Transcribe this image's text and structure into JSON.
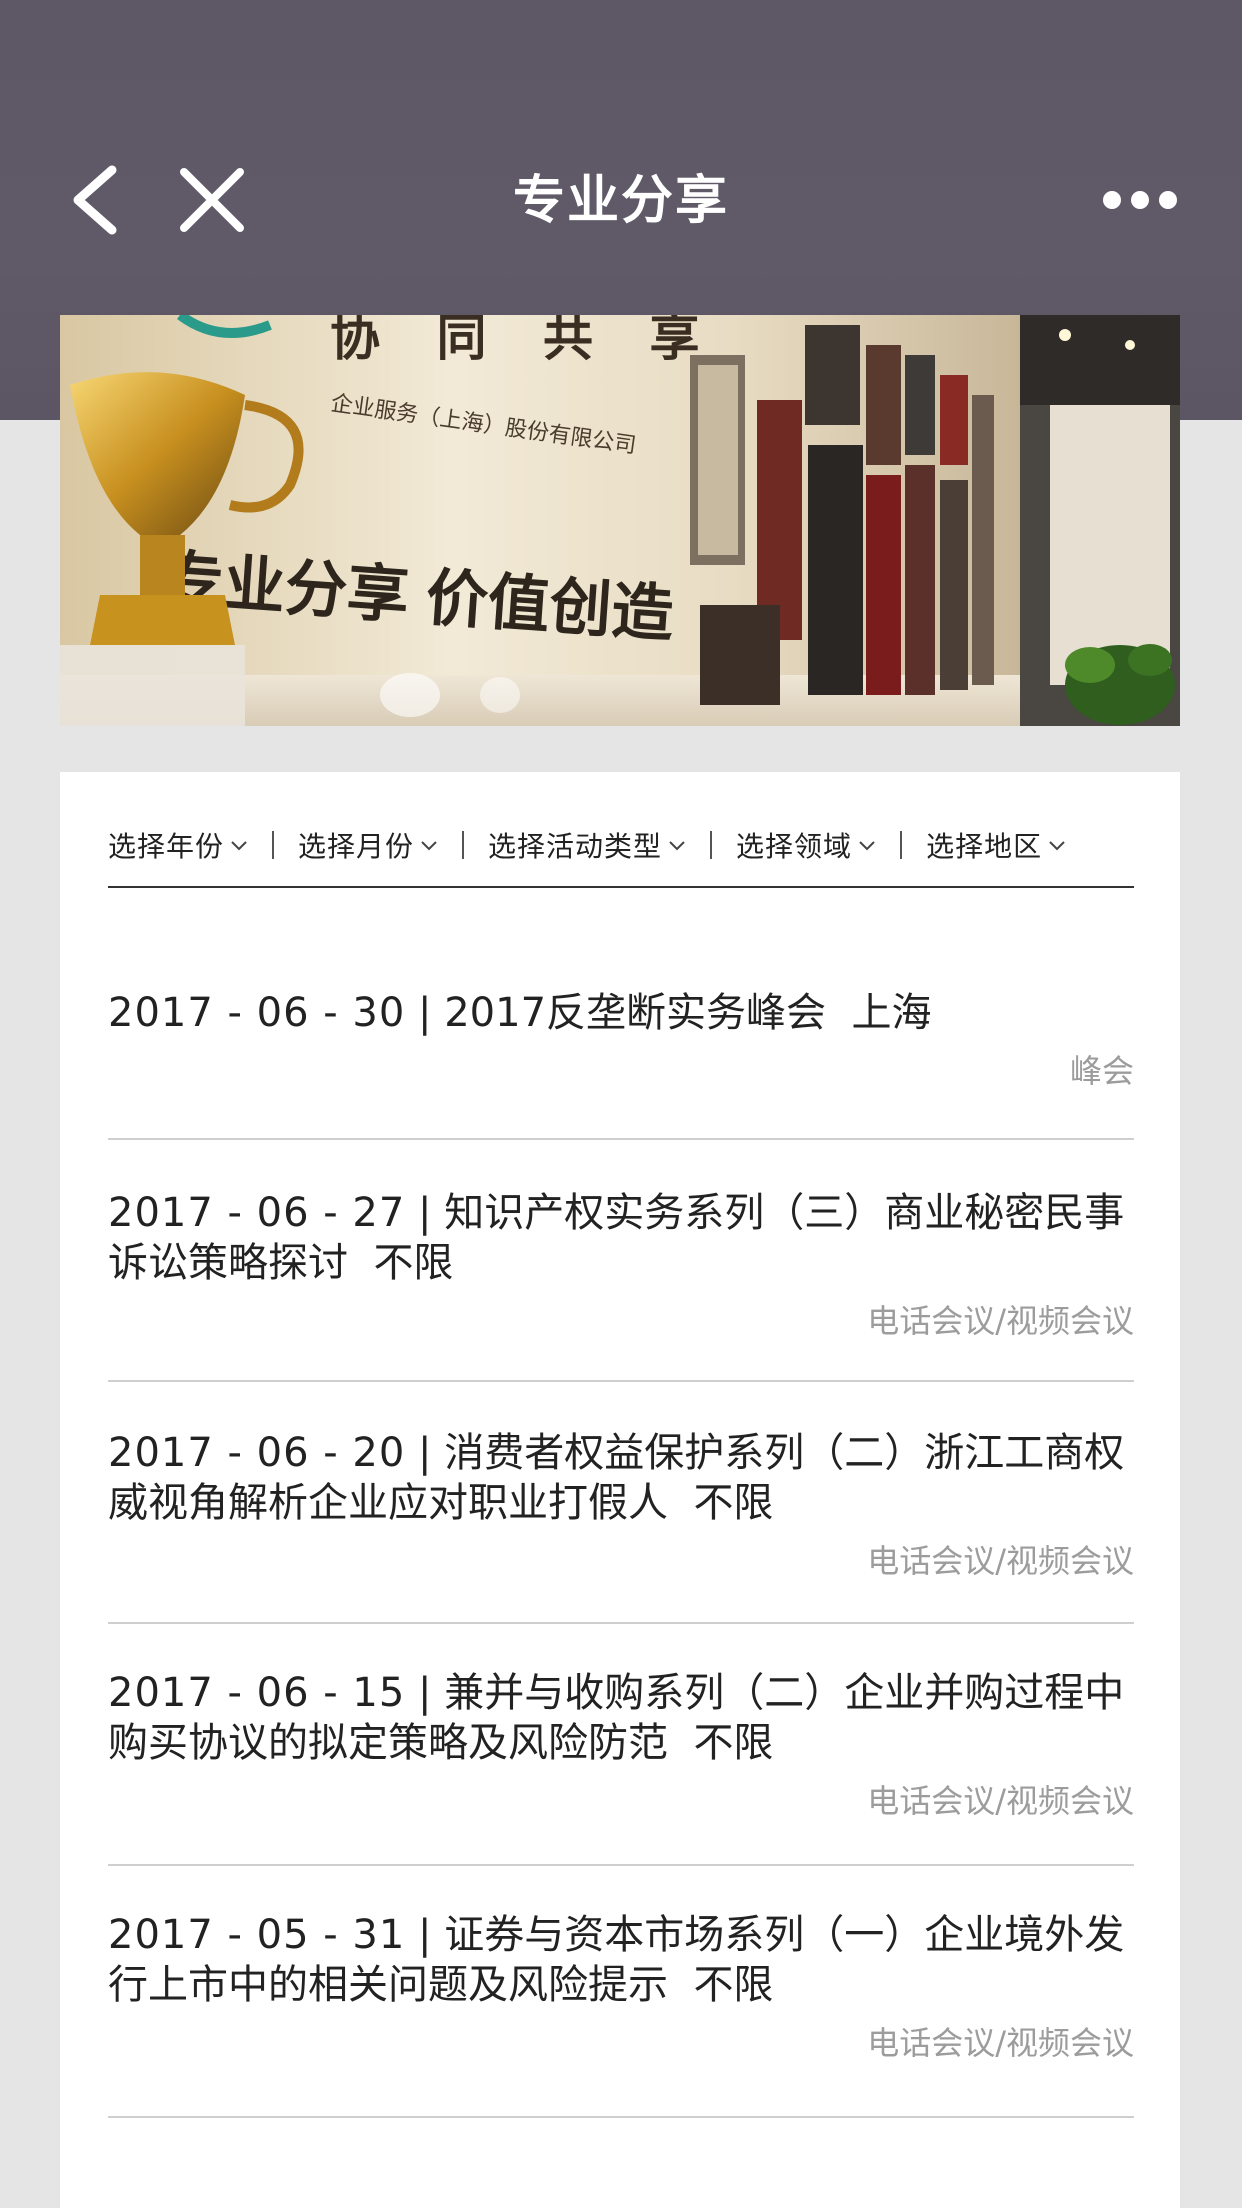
{
  "nav": {
    "title": "专业分享",
    "back_icon": "back-chevron-icon",
    "close_icon": "close-icon",
    "more_icon": "more-dots-icon"
  },
  "banner": {
    "alt": "协同共享 企业服务（上海）股份有限公司 专业分享 价值创造",
    "headline": "协 同 共 享",
    "company": "企业服务（上海）股份有限公司",
    "slogan": "专业分享 价值创造"
  },
  "filters": [
    {
      "label": "选择年份"
    },
    {
      "label": "选择月份"
    },
    {
      "label": "选择活动类型"
    },
    {
      "label": "选择领域"
    },
    {
      "label": "选择地区"
    }
  ],
  "events": [
    {
      "date": "2017 - 06 - 30",
      "title": "2017反垄断实务峰会",
      "region": "上海",
      "type": "峰会"
    },
    {
      "date": "2017 - 06 - 27",
      "title": "知识产权实务系列（三）商业秘密民事诉讼策略探讨",
      "region": "不限",
      "type": "电话会议/视频会议"
    },
    {
      "date": "2017 - 06 - 20",
      "title": "消费者权益保护系列（二）浙江工商权威视角解析企业应对职业打假人",
      "region": "不限",
      "type": "电话会议/视频会议"
    },
    {
      "date": "2017 - 06 - 15",
      "title": "兼并与收购系列（二）企业并购过程中购买协议的拟定策略及风险防范",
      "region": "不限",
      "type": "电话会议/视频会议"
    },
    {
      "date": "2017 - 05 - 31",
      "title": "证券与资本市场系列（一）企业境外发行上市中的相关问题及风险提示",
      "region": "不限",
      "type": "电话会议/视频会议"
    }
  ],
  "colors": {
    "header": "#5d5766",
    "background": "#e6e5e6",
    "type_text": "#9c9c9c"
  }
}
